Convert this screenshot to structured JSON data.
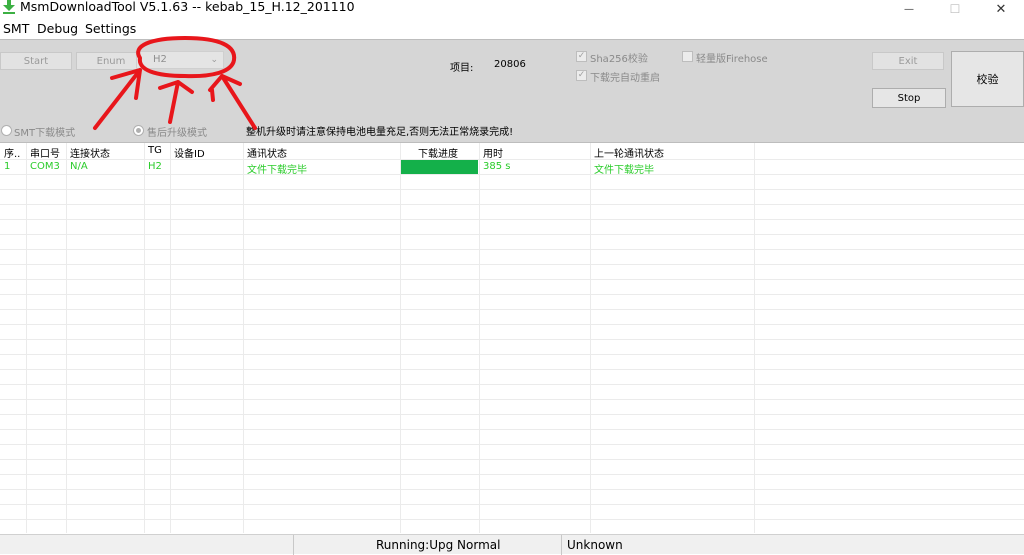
{
  "window": {
    "title": "MsmDownloadTool V5.1.63 -- kebab_15_H.12_201110",
    "minimize_glyph": "—",
    "maximize_glyph": "☐",
    "close_glyph": "✕"
  },
  "menu": [
    "SMT",
    "Debug",
    "Settings"
  ],
  "toolbar": {
    "start_label": "Start",
    "enum_label": "Enum",
    "target_value": "H2",
    "project_label": "项目:",
    "project_value": "20806",
    "sha256_label": "Sha256校验",
    "reboot_label": "下载完自动重启",
    "lite_firehose_label": "轻量版Firehose",
    "exit_label": "Exit",
    "stop_label": "Stop",
    "verify_label": "校验",
    "smt_mode_label": "SMT下载模式",
    "aftersale_mode_label": "售后升级模式",
    "warning_text": "整机升级时请注意保持电池电量充足,否则无法正常烧录完成!"
  },
  "table": {
    "headers": [
      "序..",
      "串口号",
      "连接状态",
      "TG",
      "设备ID",
      "通讯状态",
      "下载进度",
      "用时",
      "上一轮通讯状态"
    ],
    "rows": [
      {
        "index": "1",
        "port": "COM3",
        "connection": "N/A",
        "tg": "H2",
        "device_id": "",
        "comm_status": "文件下载完毕",
        "progress": 1.0,
        "elapsed": "385 s",
        "last_comm_status": "文件下载完毕"
      }
    ]
  },
  "statusbar": {
    "running": "Running:Upg Normal",
    "state": "Unknown"
  },
  "colors": {
    "toolbar_bg": "#d6d6d6",
    "success_text": "#2bcc2b",
    "progress_fill": "#14b04a",
    "annotation": "#e8161b"
  }
}
